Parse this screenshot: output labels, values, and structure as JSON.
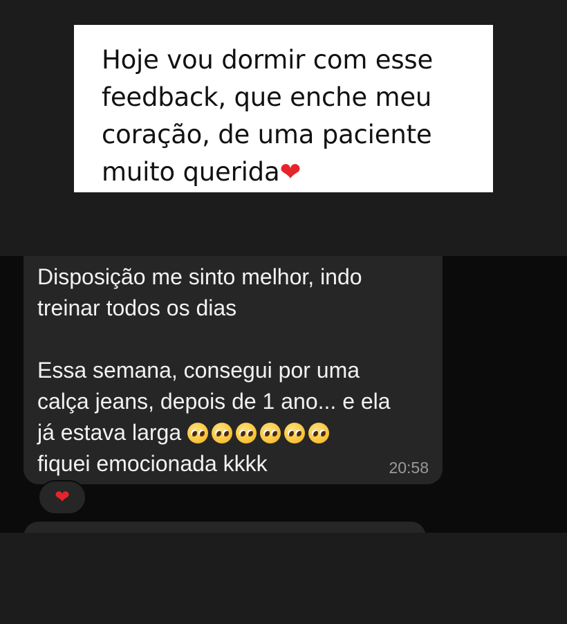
{
  "caption": {
    "lines": [
      "Hoje vou dormir com esse",
      "feedback, que enche meu",
      "coração, de uma paciente",
      "muito querida"
    ],
    "heart": "❤"
  },
  "message": {
    "line1": "Disposição me sinto melhor, indo",
    "line2": "treinar todos os dias",
    "line3": "Essa semana, consegui por uma",
    "line4": "calça jeans, depois de 1 ano... e ela",
    "line5": "já estava larga",
    "line6": "fiquei emocionada kkkk",
    "emoji_icon": "pleading-face-icon",
    "emoji_count": 6,
    "time": "20:58"
  },
  "reaction": {
    "icon": "heart-icon",
    "glyph": "❤"
  },
  "colors": {
    "top_band": "#1c1c1c",
    "chat_background": "#0b0b0b",
    "bubble": "#262626",
    "heart": "#e8242b",
    "timestamp": "#9a9a9a"
  }
}
